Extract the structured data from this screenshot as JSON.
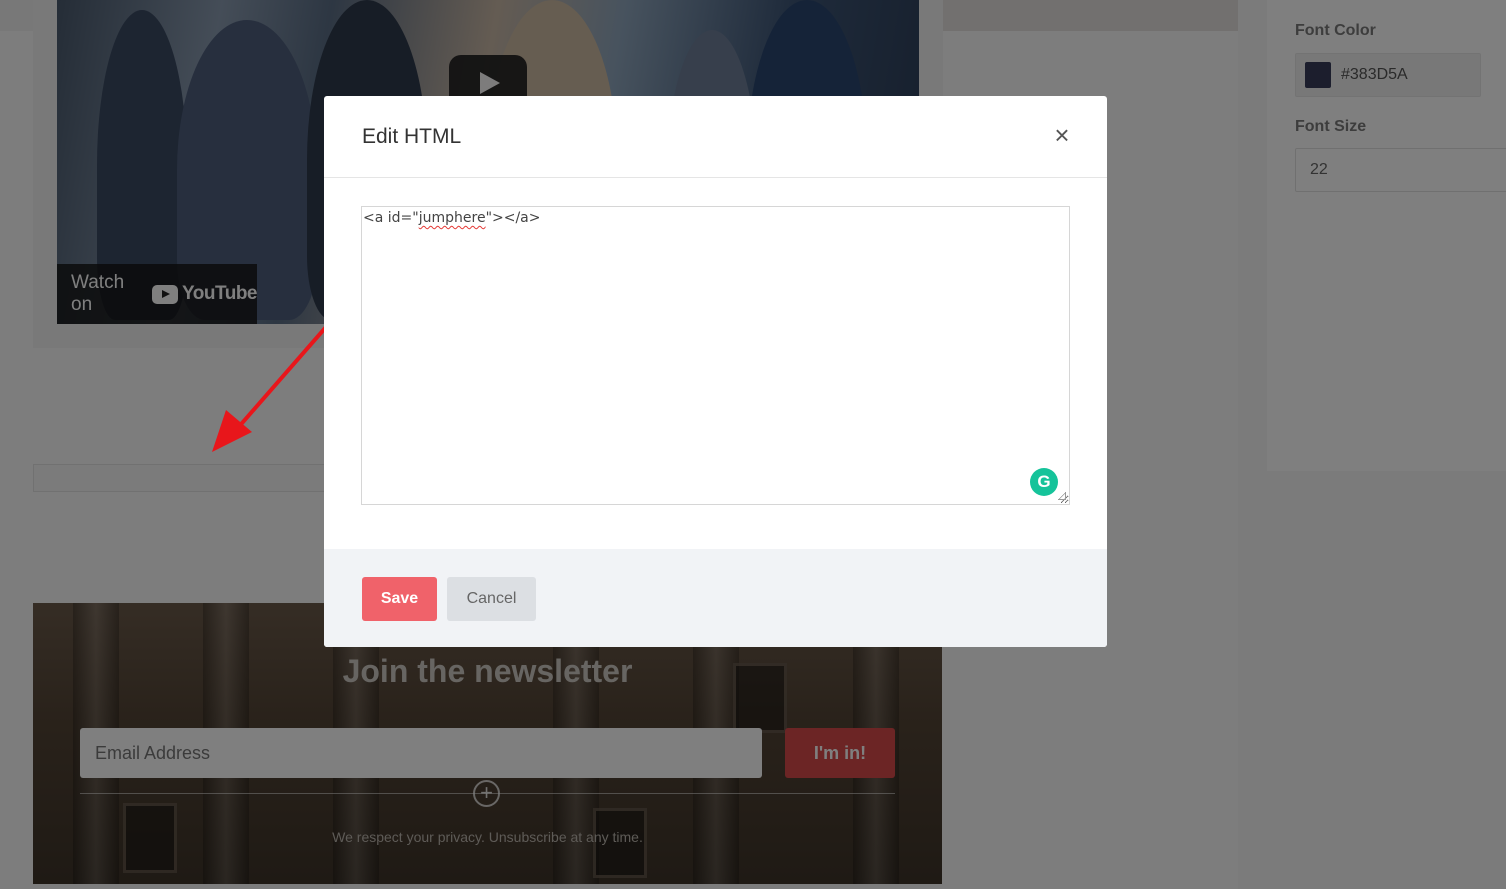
{
  "background": {
    "video": {
      "watch_on_label": "Watch on",
      "youtube_label": "YouTube"
    },
    "newsletter": {
      "title": "Join the newsletter",
      "email_placeholder": "Email Address",
      "submit_label": "I'm in!",
      "privacy_text": "We respect your privacy. Unsubscribe at any time."
    },
    "settings_panel": {
      "font_color_label": "Font Color",
      "font_color_value": "#383D5A",
      "font_size_label": "Font Size",
      "font_size_value": "22"
    }
  },
  "modal": {
    "title": "Edit HTML",
    "close_glyph": "×",
    "code_before": "<a id=\"",
    "code_misspelled": "jumphere",
    "code_after": "\"></a>",
    "grammarly_glyph": "G",
    "save_label": "Save",
    "cancel_label": "Cancel"
  },
  "colors": {
    "save_button": "#f0626a",
    "cancel_button": "#dcdfe3",
    "overlay": "rgba(0,0,0,0.5)",
    "annotation_arrow": "#e8161b",
    "grammarly": "#15c39a",
    "swatch": "#383D5A"
  },
  "icons": {
    "close": "close-icon",
    "play": "play-icon",
    "youtube": "youtube-logo-icon",
    "grammarly": "grammarly-icon",
    "add": "plus-circle-icon",
    "annotation": "red-arrow-annotation"
  }
}
